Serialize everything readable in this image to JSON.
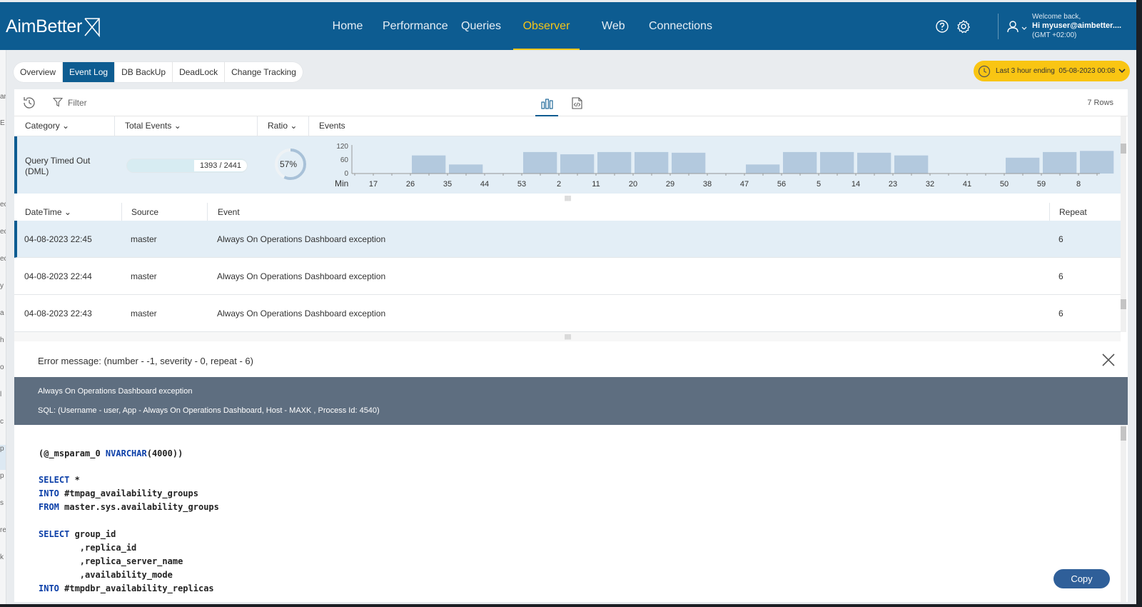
{
  "app": {
    "logo": "AimBetter"
  },
  "nav": {
    "items": [
      {
        "label": "Home"
      },
      {
        "label": "Performance"
      },
      {
        "label": "Queries"
      },
      {
        "label": "Observer"
      },
      {
        "label": "Web"
      },
      {
        "label": "Connections"
      }
    ],
    "active": "Observer",
    "active_color": "#f5c518"
  },
  "user": {
    "welcome": "Welcome back,",
    "name": "Hi myuser@aimbetter....",
    "tz": "(GMT +02:00)"
  },
  "icons": {
    "help": "help-icon",
    "settings": "gear-icon",
    "user": "user-icon"
  },
  "sidebar": {
    "letters": [
      "ar",
      "E",
      "ec",
      "ec",
      "ec",
      "y",
      "a",
      "h",
      "o",
      "l",
      "c",
      "p",
      "p",
      "s",
      "re",
      "k"
    ]
  },
  "subtabs": [
    {
      "label": "Overview"
    },
    {
      "label": "Event Log"
    },
    {
      "label": "DB BackUp"
    },
    {
      "label": "DeadLock"
    },
    {
      "label": "Change Tracking"
    }
  ],
  "time_range": {
    "label": "Last 3 hour ending",
    "value": "05-08-2023 00:08"
  },
  "toolbar": {
    "filter_label": "Filter",
    "rows_count": "7 Rows"
  },
  "category_table": {
    "headers": {
      "category": "Category",
      "total_events": "Total Events",
      "ratio": "Ratio",
      "events": "Events"
    },
    "row": {
      "name": "Query Timed Out (DML)",
      "count_label": "1393 / 2441",
      "ratio_label": "57%",
      "ratio_value": 0.57
    }
  },
  "chart_data": {
    "type": "bar",
    "xlabel": "Min",
    "categories": [
      "17",
      "",
      "26",
      "",
      "35",
      "",
      "44",
      "",
      "53",
      "",
      "2",
      "",
      "11",
      "",
      "20",
      "",
      "29",
      "",
      "38",
      "",
      "47",
      "",
      "56",
      "",
      "5",
      "",
      "14",
      "",
      "23",
      "",
      "32",
      "",
      "41",
      "",
      "50",
      "",
      "59",
      "",
      "8",
      ""
    ],
    "tick_labels": [
      "17",
      "26",
      "35",
      "44",
      "53",
      "2",
      "11",
      "20",
      "29",
      "38",
      "47",
      "56",
      "5",
      "14",
      "23",
      "32",
      "41",
      "50",
      "59",
      "8"
    ],
    "values": [
      0,
      0,
      0,
      80,
      0,
      40,
      0,
      2,
      0,
      95,
      0,
      85,
      0,
      95,
      0,
      95,
      0,
      92,
      0,
      2,
      0,
      40,
      0,
      95,
      0,
      95,
      0,
      92,
      0,
      80,
      0,
      0,
      0,
      0,
      0,
      70,
      0,
      95,
      0,
      100
    ],
    "yticks": [
      0,
      60,
      120
    ],
    "ylim": [
      0,
      120
    ],
    "bar_color": "#b3c9de"
  },
  "events_table": {
    "headers": {
      "datetime": "DateTime",
      "source": "Source",
      "event": "Event",
      "repeat": "Repeat"
    },
    "rows": [
      {
        "datetime": "04-08-2023 22:45",
        "source": "master",
        "event": "Always On Operations Dashboard exception",
        "repeat": "6"
      },
      {
        "datetime": "04-08-2023 22:44",
        "source": "master",
        "event": "Always On Operations Dashboard exception",
        "repeat": "6"
      },
      {
        "datetime": "04-08-2023 22:43",
        "source": "master",
        "event": "Always On Operations Dashboard exception",
        "repeat": "6"
      }
    ]
  },
  "error_detail": {
    "title": "Error message: (number - -1, severity - 0, repeat - 6)",
    "message": "Always On Operations Dashboard exception",
    "sql_info": "SQL: (Username - user, App - Always On Operations Dashboard, Host - MAXK , Process Id: 4540)",
    "band_color": "#5e6e80",
    "code": [
      {
        "kw": "",
        "text": "(@_msparam_0 ",
        "kw2": "NVARCHAR",
        "text2": "(4000))"
      },
      {
        "kw": "SELECT",
        "text": " *"
      },
      {
        "kw": "INTO",
        "text": " #tmpag_availability_groups"
      },
      {
        "kw": "FROM",
        "text": " master.sys.availability_groups"
      },
      {
        "kw": "SELECT",
        "text": " group_id"
      },
      {
        "kw": "",
        "text": "        ,replica_id"
      },
      {
        "kw": "",
        "text": "        ,replica_server_name"
      },
      {
        "kw": "",
        "text": "        ,availability_mode"
      },
      {
        "kw": "INTO",
        "text": " #tmpdbr_availability_replicas"
      }
    ],
    "copy_label": "Copy"
  }
}
